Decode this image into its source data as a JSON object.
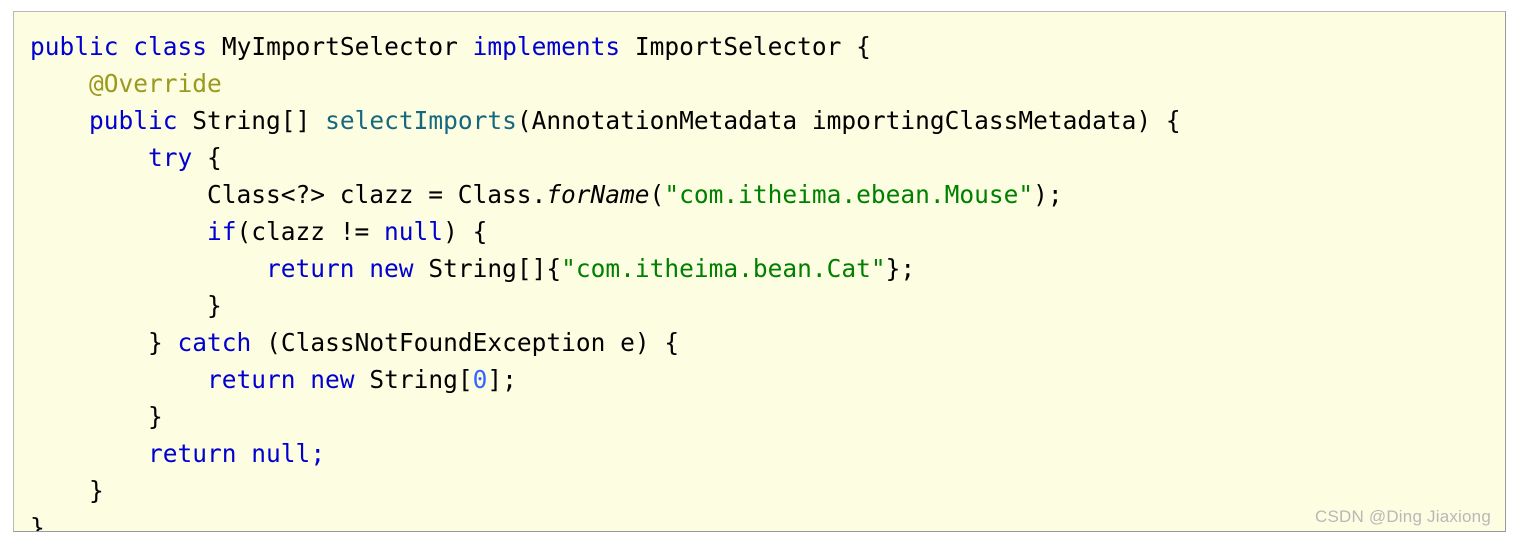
{
  "panel": {
    "background_color": "#fdfde1",
    "border_color": "#b9b9b9",
    "language": "java"
  },
  "colors": {
    "keyword": "#0000d0",
    "annotation": "#9a9a20",
    "method": "#16687e",
    "string": "#008000",
    "number": "#3366ff",
    "plain": "#000000",
    "watermark": "#b8b8b8"
  },
  "code": {
    "full_text": "public class MyImportSelector implements ImportSelector {\n    @Override\n    public String[] selectImports(AnnotationMetadata importingClassMetadata) {\n        try {\n            Class<?> clazz = Class.forName(\"com.itheima.ebean.Mouse\");\n            if(clazz != null) {\n                return new String[]{\"com.itheima.bean.Cat\"};\n            }\n        } catch (ClassNotFoundException e) {\n            return new String[0];\n        }\n        return null;\n    }\n}",
    "line_count": 14,
    "lines": [
      {
        "n": 1,
        "indent": "",
        "text": "public class MyImportSelector implements ImportSelector {"
      },
      {
        "n": 2,
        "indent": "    ",
        "text": "@Override"
      },
      {
        "n": 3,
        "indent": "    ",
        "text": "public String[] selectImports(AnnotationMetadata importingClassMetadata) {"
      },
      {
        "n": 4,
        "indent": "        ",
        "text": "try {"
      },
      {
        "n": 5,
        "indent": "            ",
        "text": "Class<?> clazz = Class.forName(\"com.itheima.ebean.Mouse\");"
      },
      {
        "n": 6,
        "indent": "            ",
        "text": "if(clazz != null) {"
      },
      {
        "n": 7,
        "indent": "                ",
        "text": "return new String[]{\"com.itheima.bean.Cat\"};"
      },
      {
        "n": 8,
        "indent": "            ",
        "text": "}"
      },
      {
        "n": 9,
        "indent": "        ",
        "text": "} catch (ClassNotFoundException e) {"
      },
      {
        "n": 10,
        "indent": "            ",
        "text": "return new String[0];"
      },
      {
        "n": 11,
        "indent": "        ",
        "text": "}"
      },
      {
        "n": 12,
        "indent": "        ",
        "text": "return null;"
      },
      {
        "n": 13,
        "indent": "    ",
        "text": "}"
      },
      {
        "n": 14,
        "indent": "",
        "text": "}"
      }
    ],
    "tokens": {
      "l1_public": "public",
      "l1_class": "class",
      "l1_classname": "MyImportSelector",
      "l1_implements": "implements",
      "l1_interface": "ImportSelector",
      "l1_brace": "{",
      "l2_annotation": "@Override",
      "l3_public": "public",
      "l3_type": "String[]",
      "l3_method": "selectImports",
      "l3_params": "(AnnotationMetadata importingClassMetadata) {",
      "l4_try": "try",
      "l4_brace": "{",
      "l5_a": "Class<?> clazz = Class.",
      "l5_forname": "forName",
      "l5_open": "(",
      "l5_string": "\"com.itheima.ebean.Mouse\"",
      "l5_close": ");",
      "l6_if": "if",
      "l6_mid": "(clazz != ",
      "l6_null": "null",
      "l6_end": ") {",
      "l7_return": "return",
      "l7_new": "new",
      "l7_type": "String[]{",
      "l7_string": "\"com.itheima.bean.Cat\"",
      "l7_end": "};",
      "l8_brace": "}",
      "l9_brace": "}",
      "l9_catch": "catch",
      "l9_rest": "(ClassNotFoundException e) {",
      "l10_return": "return",
      "l10_new": "new",
      "l10_type": "String[",
      "l10_num": "0",
      "l10_end": "];",
      "l11_brace": "}",
      "l12_return": "return",
      "l12_null": "null",
      "l12_semi": ";",
      "l13_brace": "}",
      "l14_brace": "}"
    }
  },
  "watermark": {
    "text": "CSDN @Ding Jiaxiong"
  }
}
